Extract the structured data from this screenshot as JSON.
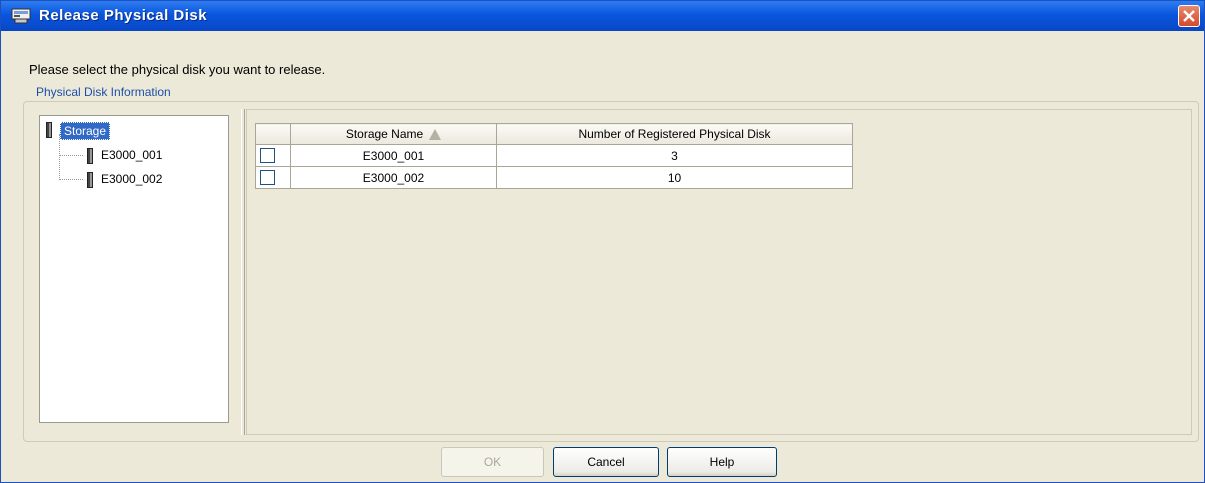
{
  "window": {
    "title": "Release Physical Disk"
  },
  "instruction": "Please select the physical disk you want to release.",
  "group_label": "Physical Disk Information",
  "tree": {
    "root": "Storage",
    "children": [
      "E3000_001",
      "E3000_002"
    ]
  },
  "table": {
    "columns": [
      "",
      "Storage Name",
      "Number of Registered Physical Disk"
    ],
    "sort_column": "Storage Name",
    "rows": [
      {
        "checked": false,
        "name": "E3000_001",
        "count": "3"
      },
      {
        "checked": false,
        "name": "E3000_002",
        "count": "10"
      }
    ]
  },
  "buttons": {
    "ok": "OK",
    "cancel": "Cancel",
    "help": "Help"
  },
  "colors": {
    "titlebar": "#0a56de",
    "dialog_bg": "#ece9d8",
    "selection": "#3169c6",
    "group_label": "#1e4fa8"
  },
  "icons": {
    "title": "disk-window-icon",
    "close": "close-icon",
    "tree_node": "disk-icon",
    "sort": "sort-ascending-icon"
  }
}
